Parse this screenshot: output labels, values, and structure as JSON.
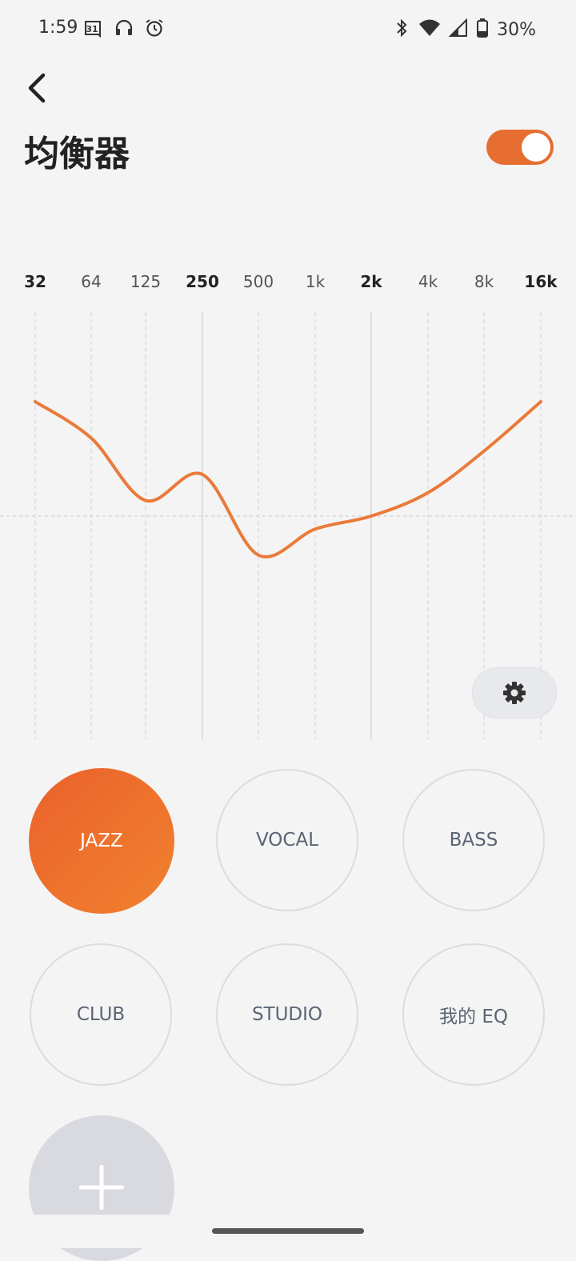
{
  "status_bar": {
    "time": "1:59",
    "calendar_day": "31",
    "battery": "30%",
    "icons": [
      "calendar-icon",
      "headphones-icon",
      "alarm-icon",
      "bluetooth-icon",
      "wifi-icon",
      "cell-signal-icon",
      "battery-icon"
    ]
  },
  "header": {
    "title": "均衡器",
    "toggle_on": true
  },
  "colors": {
    "accent": "#e66e31",
    "curve": "#ea7a3a",
    "preset_text": "#5a6474"
  },
  "chart_data": {
    "type": "line",
    "categories": [
      "32",
      "64",
      "125",
      "250",
      "500",
      "1k",
      "2k",
      "4k",
      "8k",
      "16k"
    ],
    "bold_categories": [
      "32",
      "250",
      "2k",
      "16k"
    ],
    "series": [
      {
        "values": [
          4.4,
          3.0,
          0.6,
          1.6,
          -1.5,
          -0.5,
          0.0,
          0.9,
          2.5,
          4.4
        ]
      }
    ],
    "ylim": [
      -7.8,
      7.8
    ],
    "grid": true
  },
  "presets": [
    {
      "label": "JAZZ",
      "active": true
    },
    {
      "label": "VOCAL",
      "active": false
    },
    {
      "label": "BASS",
      "active": false
    },
    {
      "label": "CLUB",
      "active": false
    },
    {
      "label": "STUDIO",
      "active": false
    },
    {
      "label": "我的 EQ",
      "active": false
    }
  ]
}
